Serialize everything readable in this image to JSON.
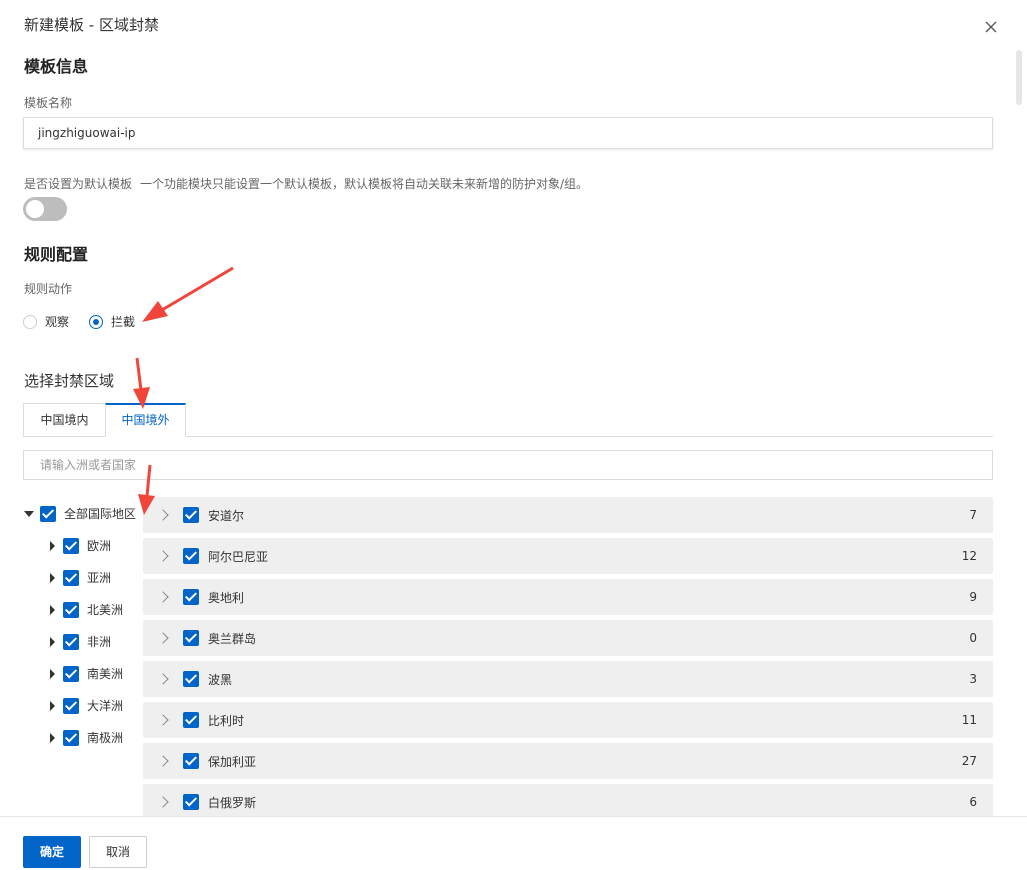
{
  "dialog": {
    "title": "新建模板 - 区域封禁"
  },
  "template_info": {
    "heading": "模板信息",
    "name_label": "模板名称",
    "name_value": "jingzhiguowai-ip",
    "default_label": "是否设置为默认模板",
    "default_hint": "一个功能模块只能设置一个默认模板，默认模板将自动关联未来新增的防护对象/组。",
    "default_enabled": false
  },
  "rule_config": {
    "heading": "规则配置",
    "action_label": "规则动作",
    "actions": [
      {
        "label": "观察",
        "selected": false
      },
      {
        "label": "拦截",
        "selected": true
      }
    ]
  },
  "region": {
    "title": "选择封禁区域",
    "tabs": [
      {
        "label": "中国境内",
        "active": false
      },
      {
        "label": "中国境外",
        "active": true
      }
    ],
    "search_placeholder": "请输入洲或者国家",
    "tree_root": {
      "label": "全部国际地区",
      "checked": true
    },
    "tree_children": [
      {
        "label": "欧洲",
        "checked": true
      },
      {
        "label": "亚洲",
        "checked": true
      },
      {
        "label": "北美洲",
        "checked": true
      },
      {
        "label": "非洲",
        "checked": true
      },
      {
        "label": "南美洲",
        "checked": true
      },
      {
        "label": "大洋洲",
        "checked": true
      },
      {
        "label": "南极洲",
        "checked": true
      }
    ],
    "countries": [
      {
        "name": "安道尔",
        "count": "7"
      },
      {
        "name": "阿尔巴尼亚",
        "count": "12"
      },
      {
        "name": "奥地利",
        "count": "9"
      },
      {
        "name": "奥兰群岛",
        "count": "0"
      },
      {
        "name": "波黑",
        "count": "3"
      },
      {
        "name": "比利时",
        "count": "11"
      },
      {
        "name": "保加利亚",
        "count": "27"
      },
      {
        "name": "白俄罗斯",
        "count": "6"
      }
    ]
  },
  "footer": {
    "ok_label": "确定",
    "cancel_label": "取消"
  },
  "colors": {
    "primary": "#0064c8",
    "annotation_arrow": "#f0453a"
  }
}
